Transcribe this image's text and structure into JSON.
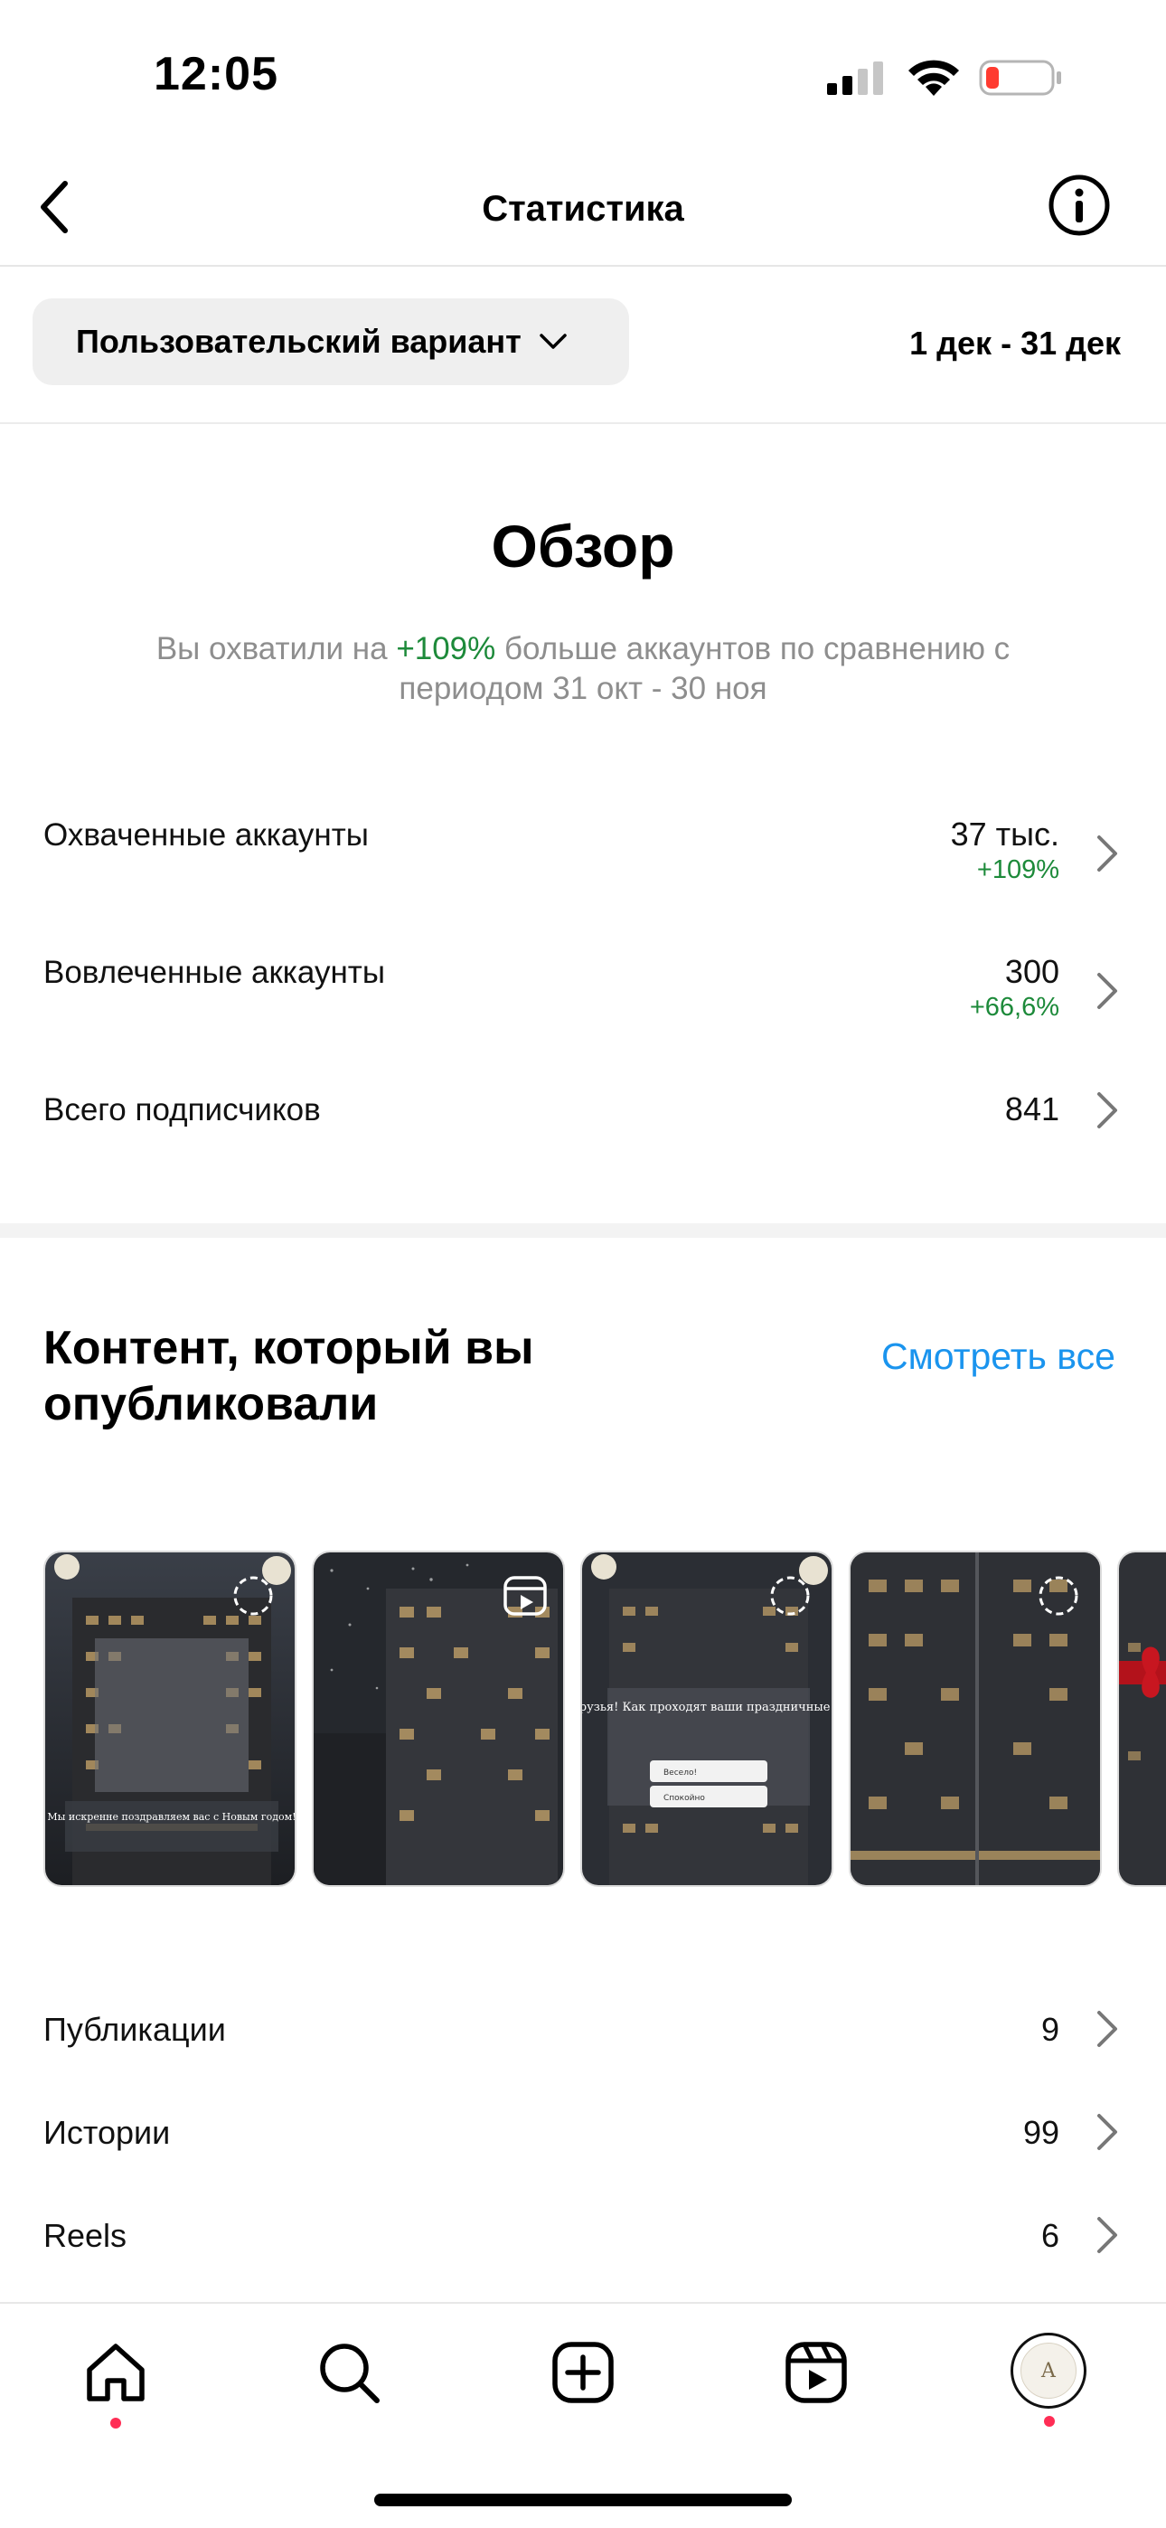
{
  "status_bar": {
    "time": "12:05"
  },
  "header": {
    "title": "Статистика"
  },
  "filter": {
    "chip_label": "Пользовательский вариант",
    "date_range": "1 дек - 31 дек"
  },
  "overview": {
    "title": "Обзор",
    "subtitle_prefix": "Вы охватили на ",
    "subtitle_delta": "+109%",
    "subtitle_suffix": " больше аккаунтов по сравнению с периодом 31 окт - 30 ноя",
    "stats": [
      {
        "label": "Охваченные аккаунты",
        "value": "37 тыс.",
        "delta": "+109%"
      },
      {
        "label": "Вовлеченные аккаунты",
        "value": "300",
        "delta": "+66,6%"
      },
      {
        "label": "Всего подписчиков",
        "value": "841"
      }
    ]
  },
  "content": {
    "title": "Контент, который вы опубликовали",
    "see_all": "Смотреть все",
    "thumbnails": [
      {
        "kind": "story",
        "icon": "story-ring-icon",
        "caption": "Мы искренне поздравляем вас с Новым годом!"
      },
      {
        "kind": "reel",
        "icon": "reels-icon"
      },
      {
        "kind": "story",
        "icon": "story-ring-icon",
        "caption": "Дорогие друзья! Как проходят ваши праздничные выходные?",
        "options": [
          "Весело!",
          "Спокойно"
        ]
      },
      {
        "kind": "story",
        "icon": "story-ring-icon"
      },
      {
        "kind": "story",
        "icon": "gift-icon"
      }
    ],
    "list": [
      {
        "label": "Публикации",
        "value": "9"
      },
      {
        "label": "Истории",
        "value": "99"
      },
      {
        "label": "Reels",
        "value": "6"
      }
    ]
  },
  "tabbar": {
    "items": [
      "home-icon",
      "search-icon",
      "create-icon",
      "reels-icon",
      "profile-avatar"
    ]
  },
  "colors": {
    "accent_green": "#1d8a3a",
    "link_blue": "#1a94ee",
    "badge_dot": "#ff2d55"
  }
}
